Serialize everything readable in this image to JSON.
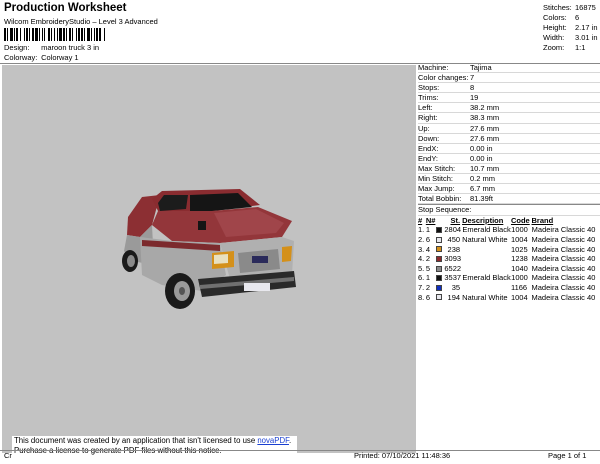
{
  "header": {
    "title": "Production Worksheet",
    "subtitle": "Wilcom EmbroideryStudio – Level 3 Advanced",
    "design_label": "Design:",
    "design_value": "maroon truck 3 in",
    "colorway_label": "Colorway:",
    "colorway_value": "Colorway 1"
  },
  "stats": [
    {
      "label": "Stitches:",
      "value": "16875"
    },
    {
      "label": "Colors:",
      "value": "6"
    },
    {
      "label": "Height:",
      "value": "2.17 in"
    },
    {
      "label": "Width:",
      "value": "3.01 in"
    },
    {
      "label": "Zoom:",
      "value": "1:1"
    }
  ],
  "properties": [
    {
      "label": "Machine:",
      "value": "Tajima"
    },
    {
      "label": "Color changes:",
      "value": "7"
    },
    {
      "label": "Stops:",
      "value": "8"
    },
    {
      "label": "Trims:",
      "value": "19"
    },
    {
      "label": "Left:",
      "value": "38.2 mm"
    },
    {
      "label": "Right:",
      "value": "38.3 mm"
    },
    {
      "label": "Up:",
      "value": "27.6 mm"
    },
    {
      "label": "Down:",
      "value": "27.6 mm"
    },
    {
      "label": "EndX:",
      "value": "0.00 in"
    },
    {
      "label": "EndY:",
      "value": "0.00 in"
    },
    {
      "label": "Max Stitch:",
      "value": "10.7 mm"
    },
    {
      "label": "Min Stitch:",
      "value": "0.2 mm"
    },
    {
      "label": "Max Jump:",
      "value": "6.7 mm"
    },
    {
      "label": "Total Bobbin:",
      "value": "81.39ft"
    }
  ],
  "stop_sequence": {
    "title": "Stop Sequence:",
    "headers": [
      "#",
      "N#",
      "St.",
      "Description",
      "Code",
      "Brand"
    ],
    "rows": [
      {
        "num": "1.",
        "n": "1",
        "color": "#111111",
        "st": "2804",
        "desc": "Emerald Black",
        "code": "1000",
        "brand": "Madeira Classic 40"
      },
      {
        "num": "2.",
        "n": "6",
        "color": "#e8e8ee",
        "st": "450",
        "desc": "Natural White",
        "code": "1004",
        "brand": "Madeira Classic 40"
      },
      {
        "num": "3.",
        "n": "4",
        "color": "#d4901a",
        "st": "238",
        "desc": "",
        "code": "1025",
        "brand": "Madeira Classic 40"
      },
      {
        "num": "4.",
        "n": "2",
        "color": "#8c2a2e",
        "st": "3093",
        "desc": "",
        "code": "1238",
        "brand": "Madeira Classic 40"
      },
      {
        "num": "5.",
        "n": "5",
        "color": "#8a8a8a",
        "st": "6522",
        "desc": "",
        "code": "1040",
        "brand": "Madeira Classic 40"
      },
      {
        "num": "6.",
        "n": "1",
        "color": "#111111",
        "st": "3537",
        "desc": "Emerald Black",
        "code": "1000",
        "brand": "Madeira Classic 40"
      },
      {
        "num": "7.",
        "n": "2",
        "color": "#1030c0",
        "st": "35",
        "desc": "",
        "code": "1166",
        "brand": "Madeira Classic 40"
      },
      {
        "num": "8.",
        "n": "6",
        "color": "#e8e8ee",
        "st": "194",
        "desc": "Natural White",
        "code": "1004",
        "brand": "Madeira Classic 40"
      }
    ]
  },
  "notice": {
    "line1_prefix": "This document was created by an application that isn't licensed to use ",
    "link": "novaPDF",
    "line1_suffix": ".",
    "line2": "Purchase a license to generate PDF files without this notice."
  },
  "footer": {
    "left": "Cr",
    "printed": "Printed: 07/10/2021 11:48:36",
    "page": "Page 1 of 1"
  }
}
